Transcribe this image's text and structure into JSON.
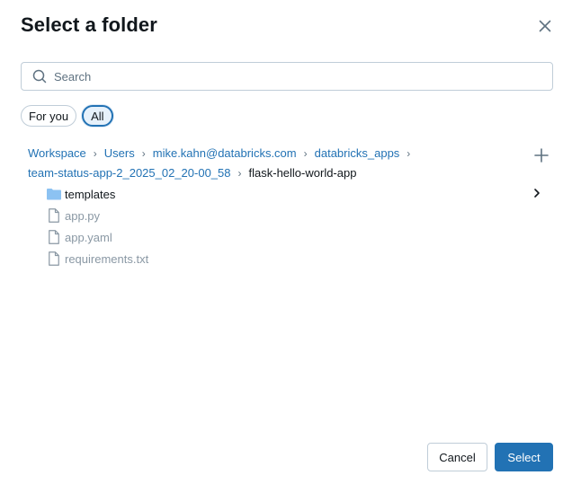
{
  "dialog": {
    "title": "Select a folder"
  },
  "search": {
    "placeholder": "Search",
    "value": ""
  },
  "filters": [
    {
      "label": "For you",
      "active": false
    },
    {
      "label": "All",
      "active": true
    }
  ],
  "breadcrumb": {
    "items": [
      "Workspace",
      "Users",
      "mike.kahn@databricks.com",
      "databricks_apps",
      "team-status-app-2_2025_02_20-00_58"
    ],
    "current": "flask-hello-world-app"
  },
  "tree": {
    "items": [
      {
        "type": "folder",
        "name": "templates"
      },
      {
        "type": "file",
        "name": "app.py"
      },
      {
        "type": "file",
        "name": "app.yaml"
      },
      {
        "type": "file",
        "name": "requirements.txt"
      }
    ]
  },
  "footer": {
    "cancel_label": "Cancel",
    "select_label": "Select"
  },
  "colors": {
    "accent": "#2272b4",
    "folder": "#8cc2f2",
    "file_text": "#8a98a4"
  }
}
